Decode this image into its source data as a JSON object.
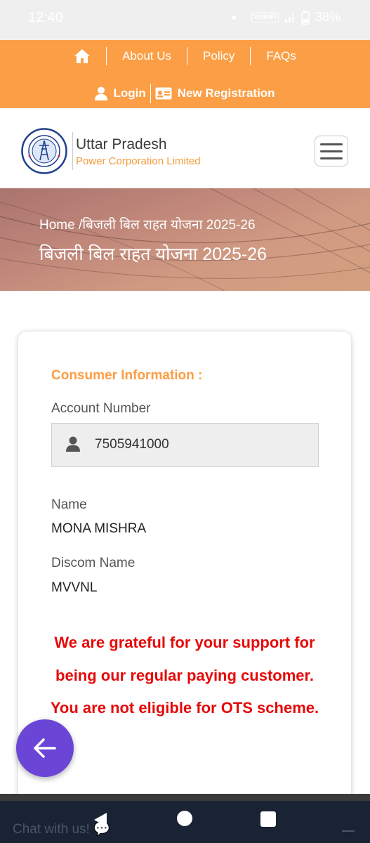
{
  "status_bar": {
    "time": "12:40",
    "network": "VoWiFi",
    "battery": "38%"
  },
  "top_nav": {
    "home_icon": "home-icon",
    "about": "About Us",
    "policy": "Policy",
    "faqs": "FAQs",
    "login": "Login",
    "new_registration": "New Registration"
  },
  "header": {
    "title": "Uttar Pradesh",
    "subtitle": "Power Corporation Limited",
    "logo_text_top": "POWER CORPORATION LIMITED",
    "logo_text_bottom": "U.P. GOVT. UNDERTAKING"
  },
  "banner": {
    "breadcrumb_home": "Home",
    "breadcrumb_sep": "/",
    "breadcrumb_current": "बिजली बिल राहत योजना 2025-26",
    "title": "बिजली बिल राहत योजना 2025-26"
  },
  "consumer": {
    "section_title": "Consumer Information :",
    "account_label": "Account Number",
    "account_value": "7505941000",
    "name_label": "Name",
    "name_value": "MONA MISHRA",
    "discom_label": "Discom Name",
    "discom_value": "MVVNL",
    "notice": "We are grateful for your support for being our regular paying customer. You are not eligible for OTS scheme."
  },
  "chat": {
    "label": "Chat with us! 💬"
  },
  "colors": {
    "accent_orange": "#fb9e45",
    "notice_red": "#e50a0a",
    "fab_purple": "#6b45d6",
    "nav_bar": "#192333"
  }
}
